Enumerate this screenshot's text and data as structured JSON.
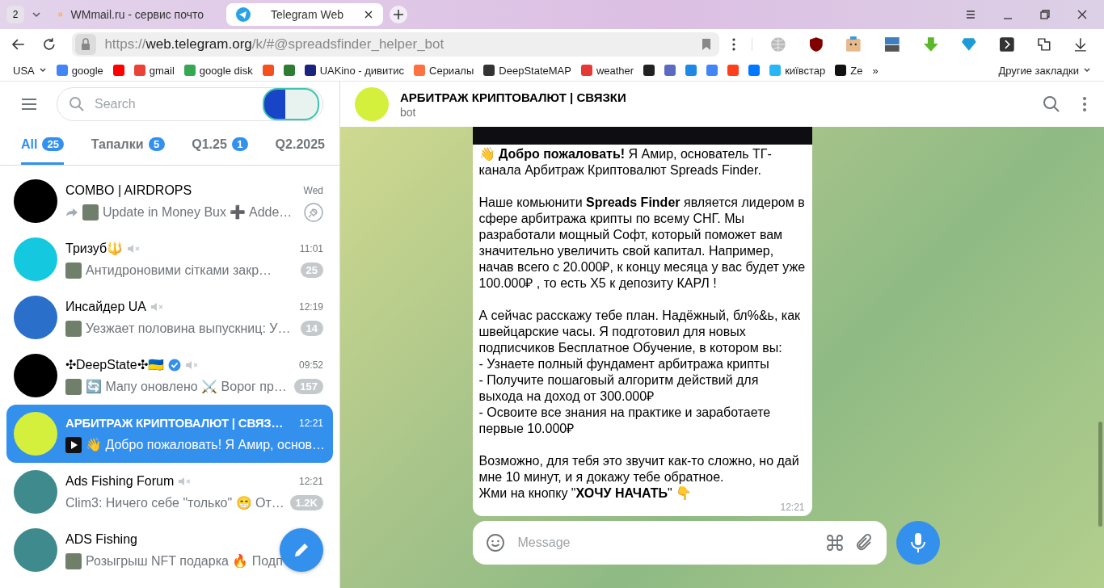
{
  "browser": {
    "tab_count": "2",
    "tabs": [
      {
        "title": "WMmail.ru - сервис почто",
        "selected": false
      },
      {
        "title": "Telegram Web",
        "selected": true
      }
    ],
    "url": {
      "scheme": "https://",
      "host": "web.telegram.org",
      "path": "/k/#@spreadsfinder_helper_bot"
    },
    "bookmarks": [
      {
        "kind": "menu",
        "label": "USA"
      },
      {
        "kind": "link",
        "label": "google",
        "color": "#4285f4"
      },
      {
        "kind": "icon",
        "color": "#ff0000"
      },
      {
        "kind": "link",
        "label": "gmail",
        "color": "#ea4335"
      },
      {
        "kind": "link",
        "label": "google disk",
        "color": "#34a853"
      },
      {
        "kind": "icon",
        "color": "#f4511e"
      },
      {
        "kind": "icon",
        "color": "#2e7d32"
      },
      {
        "kind": "link",
        "label": "UAKino - дивитис",
        "color": "#1a237e"
      },
      {
        "kind": "link",
        "label": "Сериалы",
        "color": "#ff7043"
      },
      {
        "kind": "link",
        "label": "DeepStateMAP",
        "color": "#333333"
      },
      {
        "kind": "link",
        "label": "weather",
        "color": "#e53935"
      },
      {
        "kind": "icon",
        "color": "#222222"
      },
      {
        "kind": "icon",
        "color": "#5c6bc0"
      },
      {
        "kind": "icon",
        "color": "#1e88e5"
      },
      {
        "kind": "icon",
        "color": "#4285f4"
      },
      {
        "kind": "icon",
        "color": "#fc3f1d"
      },
      {
        "kind": "icon",
        "color": "#0077ff"
      },
      {
        "kind": "link",
        "label": "київстар",
        "color": "#29b6f6"
      },
      {
        "kind": "link",
        "label": "Ze",
        "color": "#111111"
      },
      {
        "kind": "more",
        "label": "»"
      },
      {
        "kind": "folder",
        "label": "Другие закладки"
      }
    ]
  },
  "sidebar": {
    "search": {
      "placeholder": "Search"
    },
    "folders": [
      {
        "label": "All",
        "count": "25",
        "selected": true
      },
      {
        "label": "Тапалки",
        "count": "5",
        "selected": false
      },
      {
        "label": "Q1.25",
        "count": "1",
        "selected": false
      },
      {
        "label": "Q2.2025",
        "selected": false
      }
    ],
    "chats": [
      {
        "name": "COMBO | AIRDROPS",
        "time": "Wed",
        "preview": "Update in Money Bux ➕ Adde…",
        "kind": "photo",
        "forwarded": true,
        "pinned": true,
        "muted": false,
        "verified": false,
        "selected": false,
        "color": "#000000"
      },
      {
        "name": "Тризуб🔱",
        "time": "11:01",
        "preview": "Антидроновими сітками закр…",
        "kind": "photo",
        "forwarded": false,
        "badge": "25",
        "pinned": false,
        "muted": true,
        "verified": false,
        "selected": false,
        "color": "#14c8e0"
      },
      {
        "name": "Инсайдер UA",
        "time": "12:19",
        "preview": "Уезжает половина выпускниц: У…",
        "kind": "photo",
        "forwarded": false,
        "badge": "14",
        "pinned": false,
        "muted": true,
        "verified": false,
        "selected": false,
        "color": "#2a6fc9"
      },
      {
        "name": "✣DeepState✣🇺🇦",
        "time": "09:52",
        "preview": "🔄 Мапу оновлено ⚔️ Ворог пр…",
        "kind": "photo",
        "forwarded": false,
        "badge": "157",
        "pinned": false,
        "muted": true,
        "verified": true,
        "selected": false,
        "color": "#000000"
      },
      {
        "name": "АРБИТРАЖ КРИПТОВАЛЮТ | СВЯЗ…",
        "time": "12:21",
        "preview": "👋 Добро пожаловать! Я Амир, основ…",
        "kind": "video",
        "forwarded": false,
        "pinned": false,
        "muted": false,
        "verified": false,
        "selected": true,
        "color": "#d4f03c"
      },
      {
        "name": "Ads Fishing Forum",
        "time": "12:21",
        "preview": "Clim3: Ничего себе \"только\" 😁 От…",
        "kind": "text",
        "forwarded": false,
        "badge": "1.2K",
        "pinned": false,
        "muted": true,
        "verified": false,
        "selected": false,
        "color": "#3e8a8c"
      },
      {
        "name": "ADS Fishing",
        "preview": "Розыгрыш NFT подарка 🔥 Подп",
        "kind": "photo",
        "forwarded": false,
        "pinned": false,
        "muted": false,
        "verified": false,
        "selected": false,
        "color": "#3e8a8c"
      }
    ]
  },
  "chat": {
    "title": "АРБИТРАЖ КРИПТОВАЛЮТ | СВЯЗКИ",
    "subtitle": "bot",
    "message": {
      "paragraphs": [
        "👋 **Добро пожаловать!** Я Амир, основатель ТГ-канала Арбитраж Криптовалют Spreads Finder.",
        "Наше комьюнити **Spreads Finder** является лидером в сфере арбитража крипты по всему СНГ. Мы разработали мощный Софт, который поможет вам значительно увеличить свой капитал. Например, начав всего с 20.000₽, к концу месяца у вас будет уже 100.000₽ , то есть Х5 к депозиту КАРЛ !",
        "А сейчас расскажу тебе план. Надёжный, бл%&ь, как швейцарские часы. Я подготовил для новых подписчиков Бесплатное Обучение, в котором вы:\n- Узнаете полный фундамент арбитража крипты\n- Получите пошаговый алгоритм действий для выхода на доход от 300.000₽\n- Освоите все знания на практике и заработаете первые 10.000₽",
        "Возможно, для тебя это звучит как-то сложно, но дай мне 10 минут, и я докажу тебе обратное.\nЖми на кнопку \"**ХОЧУ НАЧАТЬ**\" 👇"
      ],
      "time": "12:21"
    },
    "composer": {
      "placeholder": "Message"
    }
  }
}
